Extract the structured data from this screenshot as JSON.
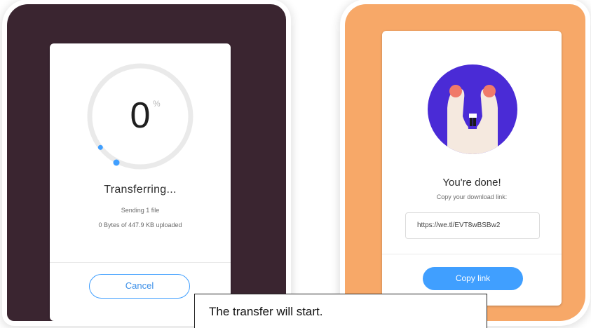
{
  "left_panel": {
    "progress_fraction": 0.0,
    "percent_value": "0",
    "percent_sign": "%",
    "status_title": "Transferring...",
    "files_line": "Sending 1 file",
    "bytes_line": "0 Bytes of 447.9 KB uploaded",
    "cancel_label": "Cancel",
    "colors": {
      "background": "#3a2530",
      "accent": "#409fff"
    }
  },
  "right_panel": {
    "done_title": "You're done!",
    "copy_prompt": "Copy your download link:",
    "download_link": "https://we.tl/EVT8wBSBw2",
    "copy_label": "Copy link",
    "illustration_icon": "raised-hands-illustration",
    "colors": {
      "background": "#f7a868",
      "accent": "#409fff",
      "illustration": "#4a2bd6"
    }
  },
  "caption": {
    "text": "The transfer will start."
  }
}
